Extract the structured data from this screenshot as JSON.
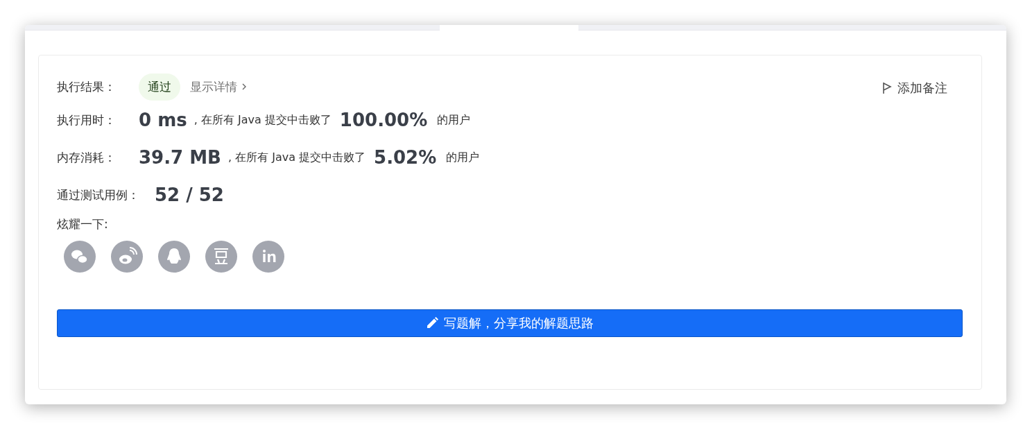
{
  "result": {
    "label": "执行结果：",
    "status": "通过",
    "details_link": "显示详情",
    "add_note": "添加备注"
  },
  "stats": [
    {
      "label": "执行用时：",
      "value": "0 ms",
      "middle": ", 在所有 Java 提交中击败了",
      "percent": "100.00%",
      "suffix": "的用户"
    },
    {
      "label": "内存消耗：",
      "value": "39.7 MB",
      "middle": ", 在所有 Java 提交中击败了",
      "percent": "5.02%",
      "suffix": "的用户"
    }
  ],
  "tests": {
    "label": "通过测试用例：",
    "value": "52 / 52"
  },
  "share": {
    "label": "炫耀一下:"
  },
  "write_button": "写题解，分享我的解题思路"
}
